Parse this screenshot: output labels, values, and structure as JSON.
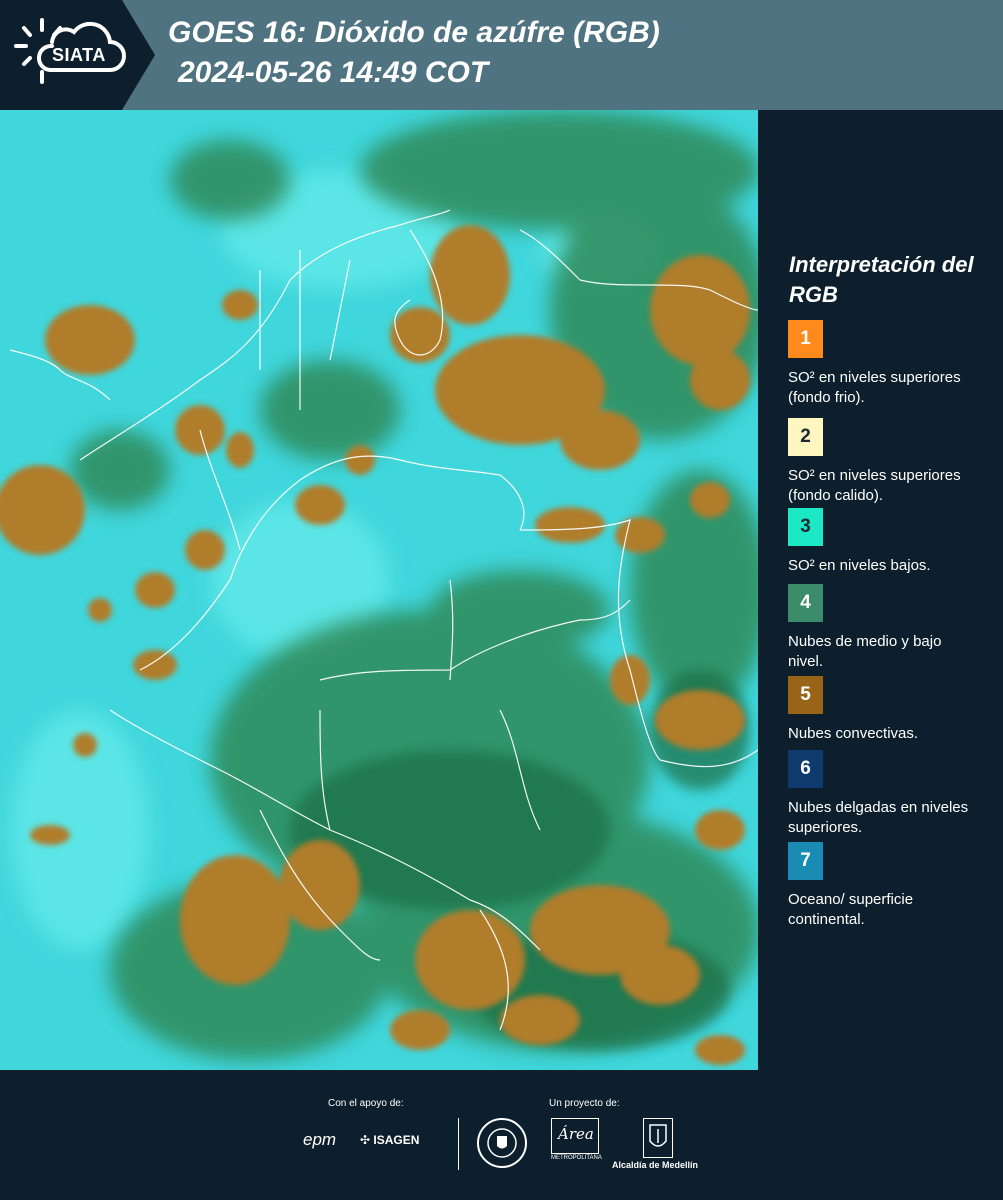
{
  "header": {
    "logo_text": "SIATA",
    "title_line1": "GOES 16: Dióxido de azúfre (RGB)",
    "title_line2": "2024-05-26 14:49 COT"
  },
  "map": {
    "colors": {
      "background_cyan": "#3fd6dc",
      "convective_brown": "#b07d2c",
      "cloud_green": "#2f8a58",
      "borders": "#ffffff"
    }
  },
  "legend": {
    "title": "Interpretación del RGB",
    "items": [
      {
        "number": "1",
        "color": "#ff8a1c",
        "description": "SO² en niveles superiores (fondo frio)."
      },
      {
        "number": "2",
        "color": "#fff6c2",
        "description": "SO² en niveles superiores (fondo calido)."
      },
      {
        "number": "3",
        "color": "#1de8c6",
        "description": "SO² en niveles bajos."
      },
      {
        "number": "4",
        "color": "#3a8c6a",
        "description": "Nubes de medio y bajo nivel."
      },
      {
        "number": "5",
        "color": "#9a6418",
        "description": "Nubes convectivas."
      },
      {
        "number": "6",
        "color": "#0e3a6e",
        "description": "Nubes delgadas en niveles superiores."
      },
      {
        "number": "7",
        "color": "#1a8cb4",
        "description": "Oceano/ superficie continental."
      }
    ]
  },
  "footer": {
    "support_label": "Con el apoyo de:",
    "project_label": "Un proyecto de:",
    "sponsors": {
      "epm": "epm",
      "isagen": "ISAGEN",
      "area": "Área",
      "area_sub": "METROPOLITANA",
      "alcaldia": "Alcaldía de Medellín"
    }
  }
}
